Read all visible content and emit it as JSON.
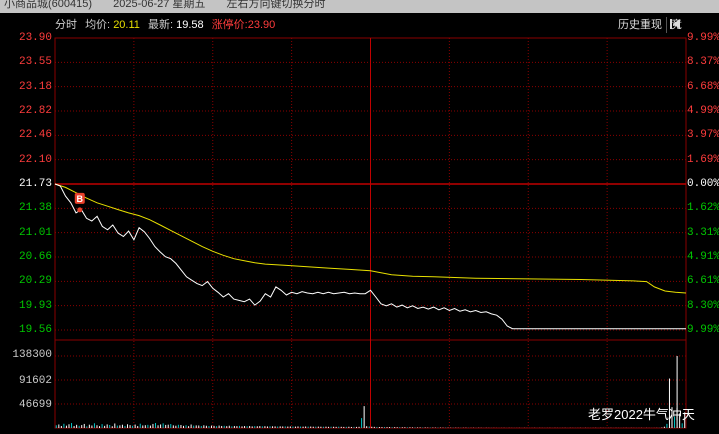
{
  "window": {
    "stock": "小商品城(600415)",
    "date": "2025-06-27 星期五",
    "hint": "左右方向键切换分时"
  },
  "info": {
    "mode": "分时",
    "avg_label": "均价:",
    "avg_value": "20.11",
    "last_label": "最新:",
    "last_value": "19.58",
    "limit_label": "涨停价:",
    "limit_value": "23.90"
  },
  "tools": {
    "history": "历史重现",
    "bid": "竞",
    "play_icon": "play-backward-icon"
  },
  "colors": {
    "grid": "#8a0000",
    "zero_line": "#c00000",
    "price_line": "#ffffff",
    "avg_line": "#e8e000",
    "up_text": "#ff3c3c",
    "down_text": "#00c800",
    "volume": "#ffffff",
    "marker": "#e8402a"
  },
  "price_axis": {
    "labels": [
      "23.90",
      "23.55",
      "23.18",
      "22.82",
      "22.46",
      "22.10",
      "21.73",
      "21.38",
      "21.01",
      "20.66",
      "20.29",
      "19.93",
      "19.56"
    ],
    "pct_labels": [
      "9.99%",
      "8.37%",
      "6.68%",
      "4.99%",
      "3.97%",
      "1.69%",
      "0.00%",
      "1.62%",
      "3.31%",
      "4.91%",
      "6.61%",
      "8.30%",
      "9.99%"
    ],
    "prev_close": "21.73"
  },
  "volume_axis": {
    "labels": [
      "138300",
      "91602",
      "46699"
    ]
  },
  "marker": {
    "label": "B"
  },
  "chart_data": {
    "type": "line",
    "title": "",
    "xlabel": "",
    "ylabel": "",
    "ylim": [
      19.56,
      23.9
    ],
    "prev_close": 21.73,
    "series": [
      {
        "name": "",
        "values": [
          [
            0,
            21.73
          ],
          [
            2,
            21.7
          ],
          [
            4,
            21.55
          ],
          [
            6,
            21.45
          ],
          [
            8,
            21.3
          ],
          [
            10,
            21.35
          ],
          [
            12,
            21.22
          ],
          [
            14,
            21.18
          ],
          [
            16,
            21.25
          ],
          [
            18,
            21.1
          ],
          [
            20,
            21.05
          ],
          [
            22,
            21.12
          ],
          [
            24,
            21.0
          ],
          [
            26,
            20.95
          ],
          [
            28,
            21.03
          ],
          [
            30,
            20.9
          ],
          [
            32,
            21.08
          ],
          [
            34,
            21.02
          ],
          [
            36,
            20.92
          ],
          [
            38,
            20.8
          ],
          [
            40,
            20.72
          ],
          [
            42,
            20.65
          ],
          [
            44,
            20.62
          ],
          [
            46,
            20.55
          ],
          [
            48,
            20.45
          ],
          [
            50,
            20.35
          ],
          [
            52,
            20.3
          ],
          [
            54,
            20.25
          ],
          [
            56,
            20.22
          ],
          [
            58,
            20.28
          ],
          [
            60,
            20.18
          ],
          [
            62,
            20.12
          ],
          [
            64,
            20.05
          ],
          [
            66,
            20.1
          ],
          [
            68,
            20.02
          ],
          [
            70,
            20.0
          ],
          [
            72,
            19.98
          ],
          [
            74,
            20.02
          ],
          [
            76,
            19.93
          ],
          [
            78,
            19.99
          ],
          [
            80,
            20.1
          ],
          [
            82,
            20.05
          ],
          [
            84,
            20.2
          ],
          [
            86,
            20.15
          ],
          [
            88,
            20.08
          ],
          [
            90,
            20.12
          ],
          [
            92,
            20.1
          ],
          [
            94,
            20.13
          ],
          [
            96,
            20.11
          ],
          [
            98,
            20.1
          ],
          [
            100,
            20.12
          ],
          [
            102,
            20.1
          ],
          [
            104,
            20.12
          ],
          [
            106,
            20.1
          ],
          [
            108,
            20.11
          ],
          [
            110,
            20.12
          ],
          [
            112,
            20.1
          ],
          [
            114,
            20.11
          ],
          [
            116,
            20.1
          ],
          [
            118,
            20.1
          ],
          [
            120,
            20.15
          ],
          [
            122,
            20.05
          ],
          [
            124,
            19.95
          ],
          [
            126,
            19.92
          ],
          [
            128,
            19.95
          ],
          [
            130,
            19.9
          ],
          [
            132,
            19.93
          ],
          [
            134,
            19.89
          ],
          [
            136,
            19.92
          ],
          [
            138,
            19.88
          ],
          [
            140,
            19.9
          ],
          [
            142,
            19.87
          ],
          [
            144,
            19.9
          ],
          [
            146,
            19.86
          ],
          [
            148,
            19.89
          ],
          [
            150,
            19.85
          ],
          [
            152,
            19.88
          ],
          [
            154,
            19.84
          ],
          [
            156,
            19.86
          ],
          [
            158,
            19.83
          ],
          [
            160,
            19.85
          ],
          [
            162,
            19.82
          ],
          [
            164,
            19.83
          ],
          [
            166,
            19.8
          ],
          [
            168,
            19.78
          ],
          [
            170,
            19.72
          ],
          [
            172,
            19.62
          ],
          [
            174,
            19.58
          ],
          [
            176,
            19.58
          ],
          [
            240,
            19.58
          ]
        ]
      },
      {
        "name": "",
        "values": [
          [
            0,
            21.73
          ],
          [
            4,
            21.68
          ],
          [
            8,
            21.6
          ],
          [
            12,
            21.52
          ],
          [
            16,
            21.45
          ],
          [
            20,
            21.4
          ],
          [
            24,
            21.35
          ],
          [
            28,
            21.3
          ],
          [
            32,
            21.26
          ],
          [
            36,
            21.2
          ],
          [
            40,
            21.12
          ],
          [
            44,
            21.04
          ],
          [
            48,
            20.96
          ],
          [
            52,
            20.88
          ],
          [
            56,
            20.8
          ],
          [
            60,
            20.73
          ],
          [
            64,
            20.67
          ],
          [
            68,
            20.62
          ],
          [
            72,
            20.59
          ],
          [
            76,
            20.56
          ],
          [
            80,
            20.54
          ],
          [
            88,
            20.52
          ],
          [
            96,
            20.5
          ],
          [
            104,
            20.48
          ],
          [
            112,
            20.46
          ],
          [
            120,
            20.44
          ],
          [
            124,
            20.41
          ],
          [
            128,
            20.38
          ],
          [
            136,
            20.36
          ],
          [
            144,
            20.35
          ],
          [
            160,
            20.33
          ],
          [
            180,
            20.32
          ],
          [
            200,
            20.31
          ],
          [
            220,
            20.29
          ],
          [
            225,
            20.28
          ],
          [
            228,
            20.2
          ],
          [
            232,
            20.14
          ],
          [
            236,
            20.12
          ],
          [
            240,
            20.11
          ]
        ]
      }
    ],
    "volume": {
      "ylim": [
        0,
        138300
      ],
      "labels": [
        "138300",
        "91602",
        "46699"
      ],
      "values": [
        5200,
        6800,
        3900,
        8100,
        4500,
        7200,
        9500,
        3800,
        6100,
        4200,
        5600,
        7800,
        3200,
        6400,
        4800,
        9100,
        5300,
        3600,
        7400,
        4100,
        6900,
        5800,
        3400,
        8700,
        4600,
        5100,
        6300,
        3900,
        7100,
        5500,
        4300,
        6600,
        3700,
        8300,
        4900,
        5400,
        6100,
        4700,
        7800,
        9600,
        5200,
        6800,
        8900,
        5900,
        6400,
        7600,
        5100,
        4400,
        6200,
        5800,
        4100,
        5300,
        3600,
        6700,
        4500,
        5000,
        4800,
        3900,
        5200,
        4300,
        3800,
        4600,
        4100,
        3500,
        4700,
        3900,
        4200,
        3600,
        4400,
        3300,
        3900,
        3700,
        4100,
        3200,
        3800,
        3500,
        3900,
        3100,
        3600,
        3400,
        3800,
        3200,
        3500,
        3000,
        3400,
        3300,
        3100,
        2900,
        3200,
        3000,
        3100,
        2800,
        3000,
        2900,
        2700,
        3100,
        2800,
        2600,
        2900,
        2700,
        2800,
        2500,
        2600,
        2700,
        2500,
        2400,
        2600,
        2300,
        2500,
        2400,
        2200,
        2500,
        2300,
        2100,
        2200,
        2400,
        2000,
        2200,
        2100,
        2300,
        19000,
        42000,
        3500,
        2800,
        2400,
        2200,
        2000,
        1900,
        1800,
        1900,
        1700,
        1800,
        1600,
        1700,
        1500,
        1600,
        1400,
        1500,
        1300,
        1400,
        1200,
        1300,
        1100,
        1200,
        1000,
        1100,
        900,
        1000,
        900,
        800,
        900,
        800,
        700,
        800,
        700,
        600,
        700,
        600,
        500,
        600,
        500,
        600,
        500,
        400,
        500,
        400,
        500,
        400,
        300,
        400,
        300,
        400,
        300,
        200,
        300,
        200,
        300,
        200,
        300,
        200,
        300,
        200,
        300,
        200,
        300,
        200,
        300,
        200,
        300,
        200,
        300,
        200,
        300,
        200,
        300,
        200,
        300,
        200,
        300,
        200,
        300,
        200,
        300,
        200,
        300,
        200,
        300,
        200,
        300,
        200,
        300,
        200,
        300,
        200,
        300,
        200,
        300,
        200,
        300,
        200,
        300,
        200,
        300,
        200,
        300,
        200,
        300,
        200,
        300,
        200,
        300,
        200,
        300,
        200,
        300,
        200,
        300,
        400,
        900,
        2500,
        8000,
        95000,
        40000,
        22000,
        138300,
        28000,
        9000,
        30000
      ]
    }
  }
}
